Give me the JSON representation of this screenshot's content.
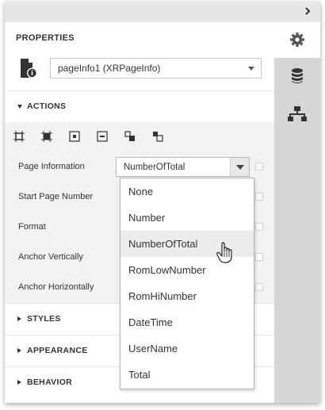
{
  "panel": {
    "title": "PROPERTIES",
    "control_selector": {
      "value": "pageInfo1 (XRPageInfo)"
    }
  },
  "sections": {
    "actions": "ACTIONS",
    "styles": "STYLES",
    "appearance": "APPEARANCE",
    "behavior": "BEHAVIOR"
  },
  "toolbar_icons": [
    "fit-bounds-icon",
    "fit-to-container-icon",
    "center-horizontal-icon",
    "center-vertical-icon",
    "bring-to-front-icon",
    "send-to-back-icon"
  ],
  "properties": [
    {
      "label": "Page Information"
    },
    {
      "label": "Start Page Number"
    },
    {
      "label": "Format"
    },
    {
      "label": "Anchor Vertically"
    },
    {
      "label": "Anchor Horizontally"
    }
  ],
  "page_information": {
    "value": "NumberOfTotal",
    "options": [
      "None",
      "Number",
      "NumberOfTotal",
      "RomLowNumber",
      "RomHiNumber",
      "DateTime",
      "UserName",
      "Total"
    ],
    "hovered": "NumberOfTotal"
  },
  "side_tabs": [
    "gear-icon",
    "database-icon",
    "hierarchy-icon"
  ],
  "colors": {
    "side_bar": "#d6d6d6",
    "actions_bg": "#f2f2f2",
    "hover_item": "#ececec"
  }
}
